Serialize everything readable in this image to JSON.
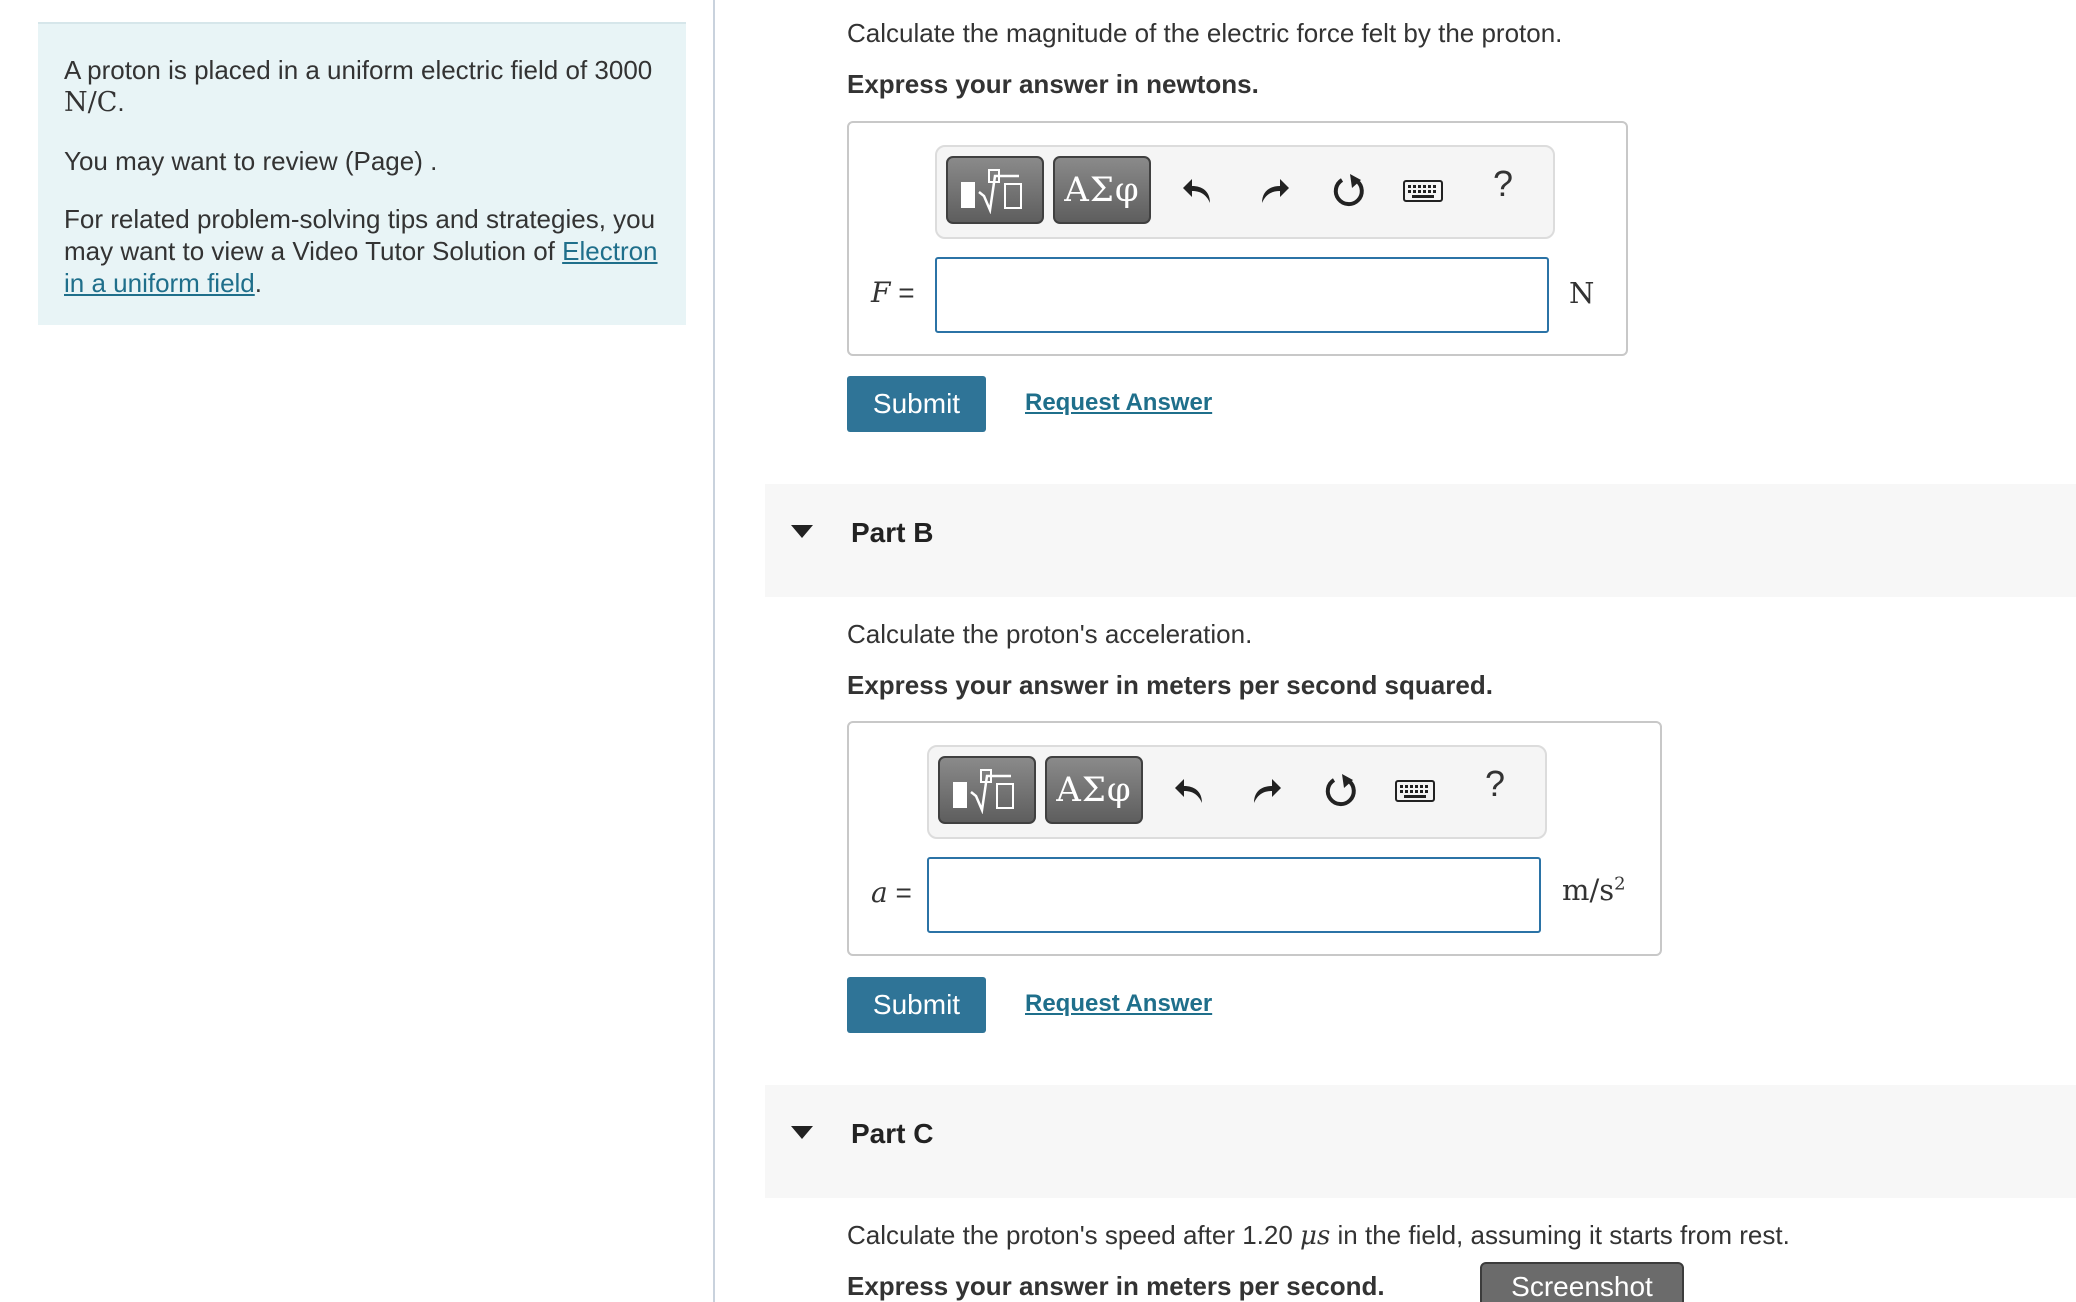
{
  "left_panel": {
    "intro_text": "A proton is placed in a uniform electric field of",
    "field_value": "3000",
    "field_unit": "N/C",
    "field_period": ".",
    "review_text": "You may want to review (Page) .",
    "tips_text": "For related problem-solving tips and strategies, you may want to view a Video Tutor Solution of",
    "video_link": "Electron in a uniform field",
    "video_link_period": "."
  },
  "part_a": {
    "question": "Calculate the magnitude of the electric force felt by the proton.",
    "instruction": "Express your answer in newtons.",
    "variable": "F",
    "equals": "=",
    "unit": "N",
    "input_value": "",
    "submit_label": "Submit",
    "request_label": "Request Answer"
  },
  "part_b": {
    "title": "Part B",
    "question": "Calculate the proton's acceleration.",
    "instruction": "Express your answer in meters per second squared.",
    "variable": "a",
    "equals": "=",
    "unit_base": "m/s",
    "unit_exp": "2",
    "input_value": "",
    "submit_label": "Submit",
    "request_label": "Request Answer"
  },
  "part_c": {
    "title": "Part C",
    "question_pre": "Calculate the proton's speed after 1.20",
    "question_mu": "μs",
    "question_post": "in the field, assuming it starts from rest.",
    "instruction": "Express your answer in meters per second."
  },
  "toolbar": {
    "greek_label": "ΑΣφ",
    "help_label": "?",
    "icons": [
      "templates-icon",
      "greek-letters-icon",
      "undo-icon",
      "redo-icon",
      "reset-icon",
      "keyboard-icon",
      "help-icon"
    ]
  },
  "screenshot_label": "Screenshot",
  "colors": {
    "panel_bg": "#e8f4f6",
    "accent": "#2f7497",
    "link": "#1f6f8b",
    "input_border": "#2b73a6"
  }
}
